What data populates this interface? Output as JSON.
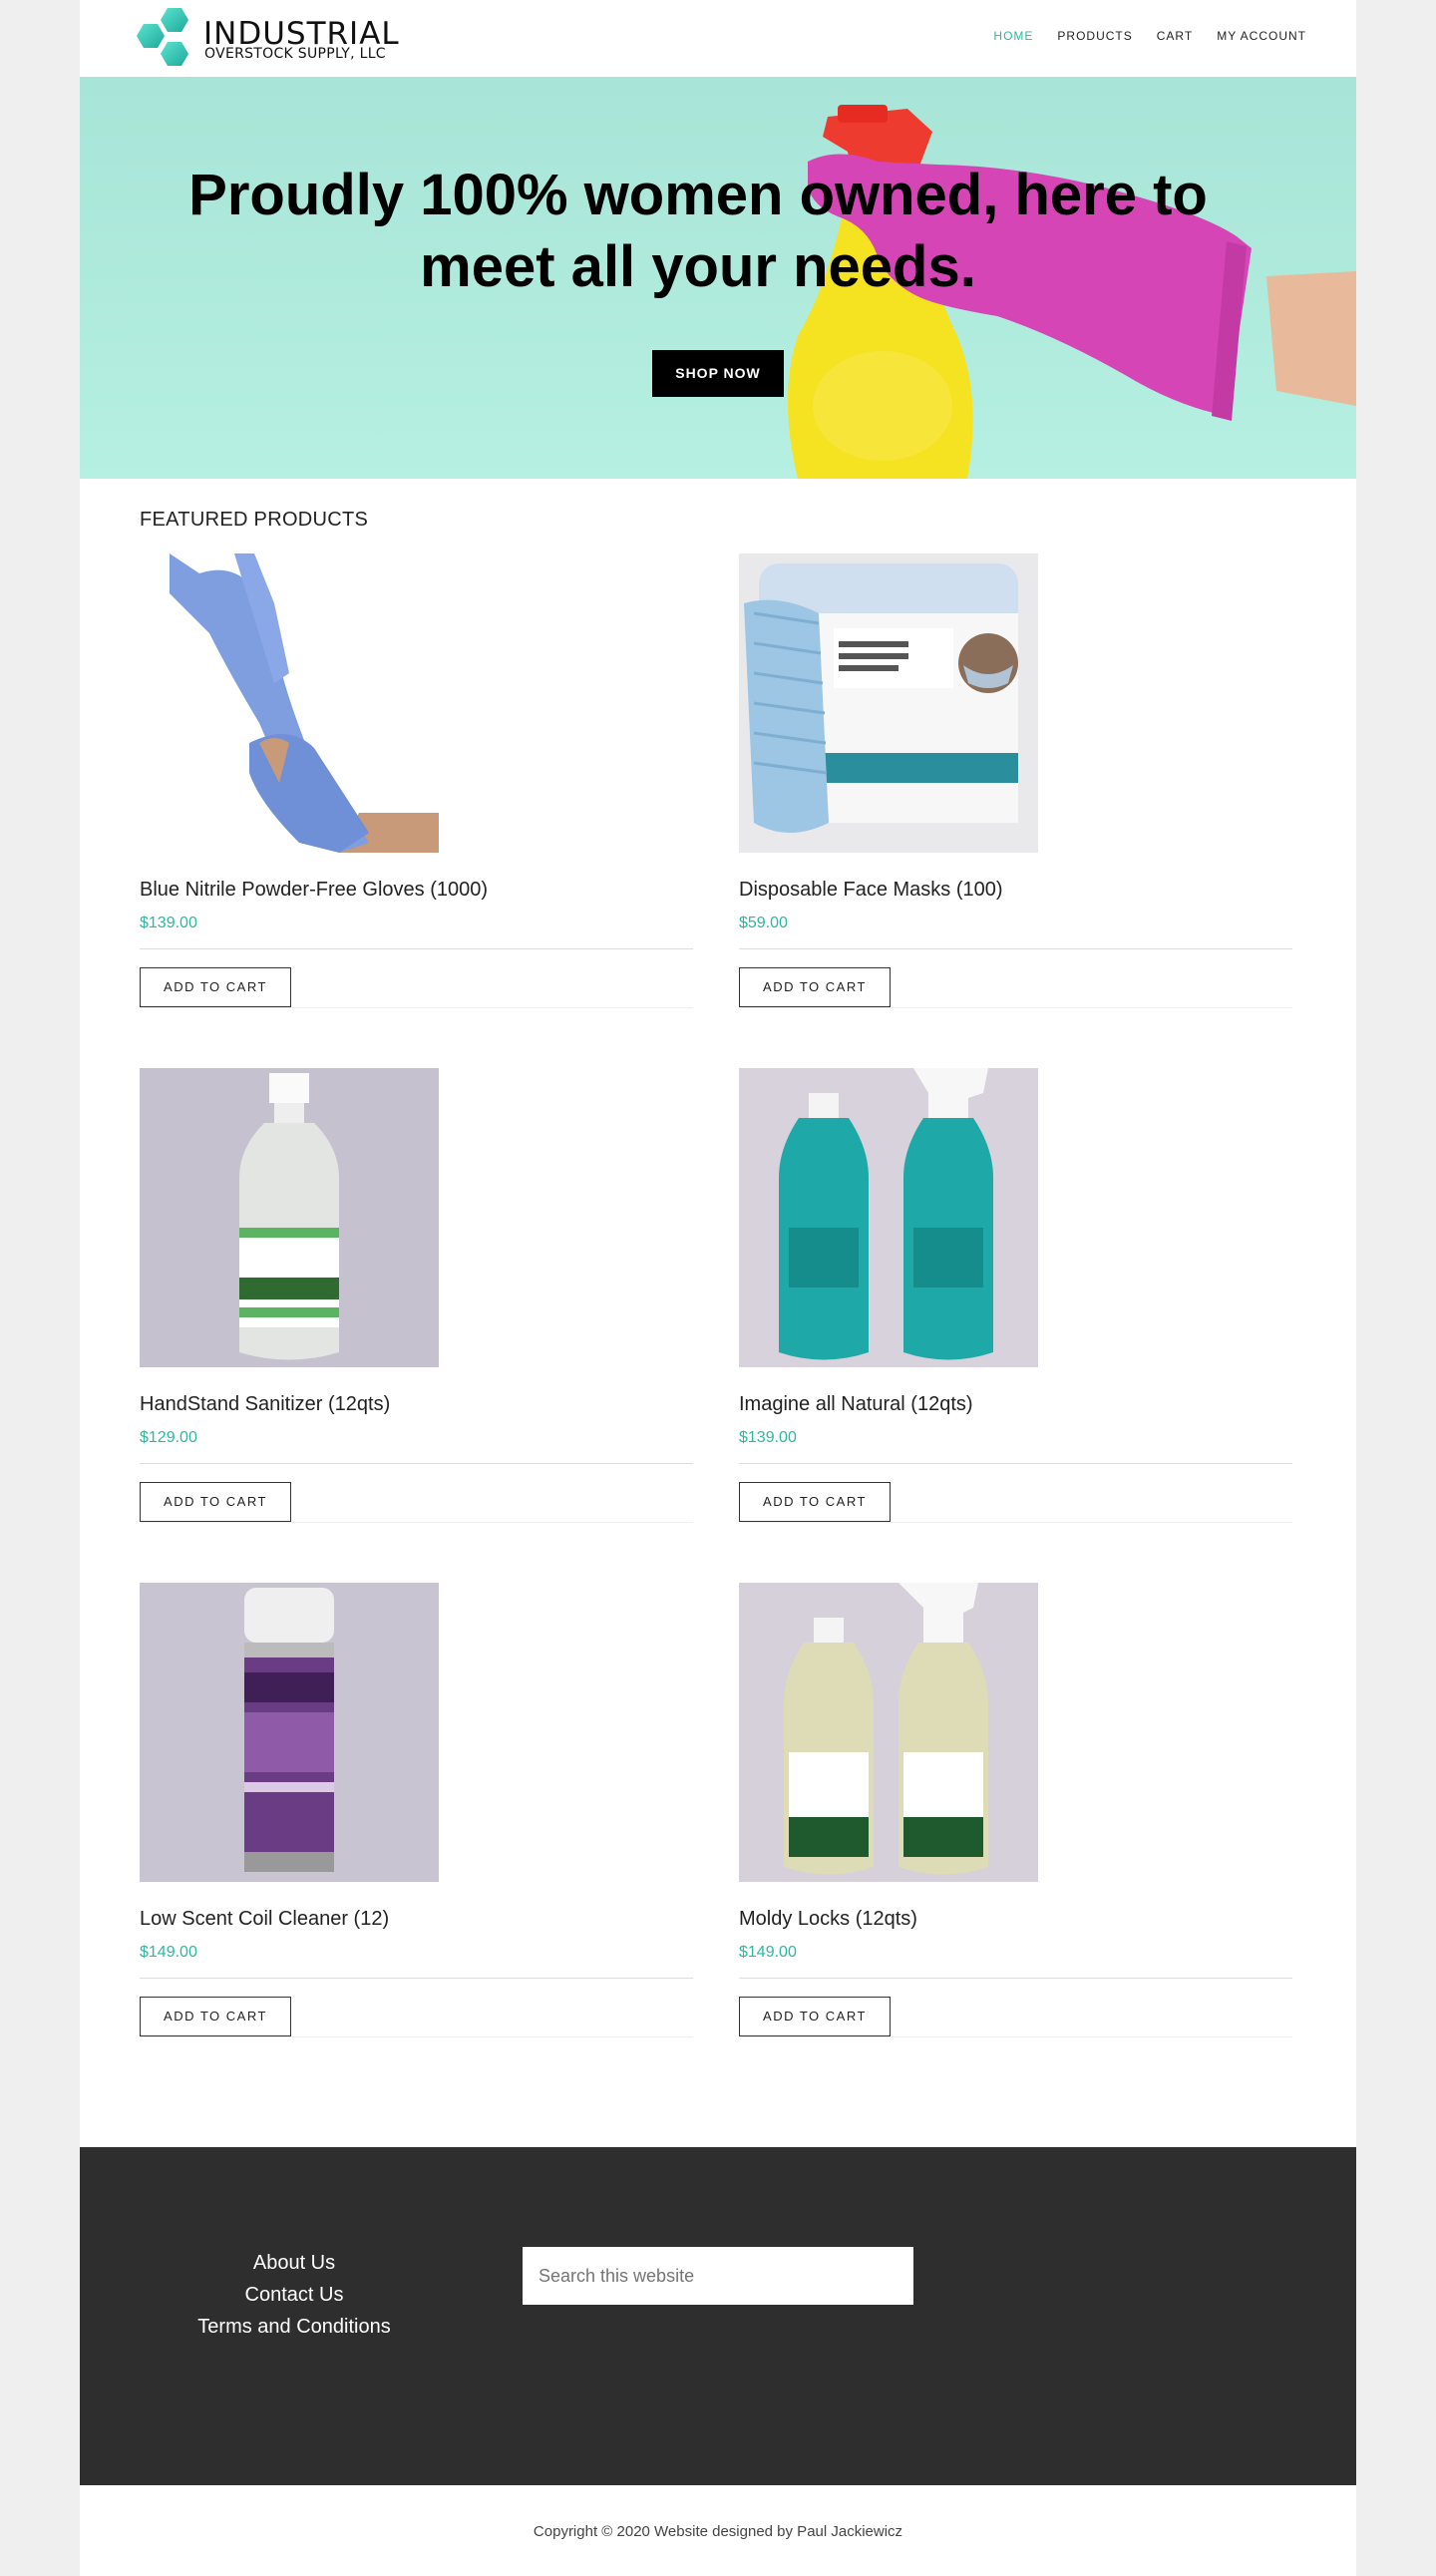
{
  "brand": {
    "title": "INDUSTRIAL",
    "subtitle": "OVERSTOCK SUPPLY, LLC",
    "logo_color": "#2bb8a1"
  },
  "nav": {
    "items": [
      "HOME",
      "PRODUCTS",
      "CART",
      "MY ACCOUNT"
    ],
    "active": "HOME"
  },
  "hero": {
    "headline": "Proudly 100% women owned, here to meet all your needs.",
    "button": "SHOP NOW",
    "background": "#aee9dc"
  },
  "featured": {
    "title": "FEATURED PRODUCTS",
    "products": [
      {
        "name": "Blue Nitrile Powder-Free Gloves (1000)",
        "price": "$139.00",
        "button": "ADD TO CART",
        "icon": "nitrile-gloves-image"
      },
      {
        "name": "Disposable Face Masks (100)",
        "price": "$59.00",
        "button": "ADD TO CART",
        "icon": "face-masks-image"
      },
      {
        "name": "HandStand Sanitizer (12qts)",
        "price": "$129.00",
        "button": "ADD TO CART",
        "icon": "sanitizer-bottle-image"
      },
      {
        "name": "Imagine all Natural (12qts)",
        "price": "$139.00",
        "button": "ADD TO CART",
        "icon": "spray-bottles-image"
      },
      {
        "name": "Low Scent Coil Cleaner (12)",
        "price": "$149.00",
        "button": "ADD TO CART",
        "icon": "aerosol-can-image"
      },
      {
        "name": "Moldy Locks (12qts)",
        "price": "$149.00",
        "button": "ADD TO CART",
        "icon": "spray-bottles-image"
      }
    ]
  },
  "footer": {
    "links": [
      "About Us",
      "Contact Us",
      "Terms and Conditions"
    ],
    "search_placeholder": "Search this website",
    "copyright": "Copyright © 2020 Website designed by Paul Jackiewicz"
  },
  "colors": {
    "accent": "#2bb8a1",
    "footer_bg": "#2e2e2e"
  }
}
